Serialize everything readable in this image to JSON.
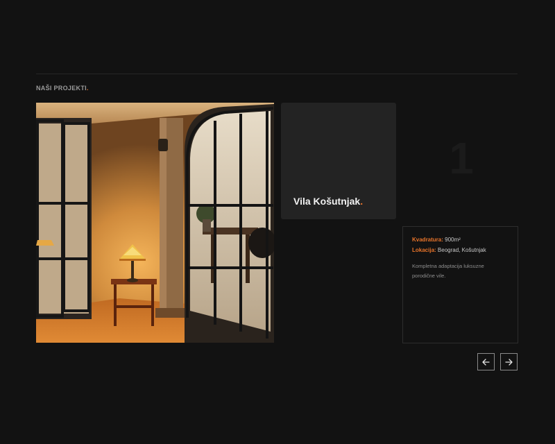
{
  "section": {
    "title": "NAŠI PROJEKTI",
    "title_dot": "."
  },
  "project": {
    "name": "Vila Košutnjak",
    "name_dot": ".",
    "index": "1",
    "area_label": "Kvadratura:",
    "area_value": "900m²",
    "location_label": "Lokacija:",
    "location_value": "Beograd, Košutnjak",
    "description": "Kompletna adaptacija luksuzne porodične vile."
  },
  "nav": {
    "prev_icon": "arrow-left-icon",
    "next_icon": "arrow-right-icon"
  },
  "colors": {
    "background": "#121212",
    "accent": "#e8742a",
    "card": "#232323"
  }
}
